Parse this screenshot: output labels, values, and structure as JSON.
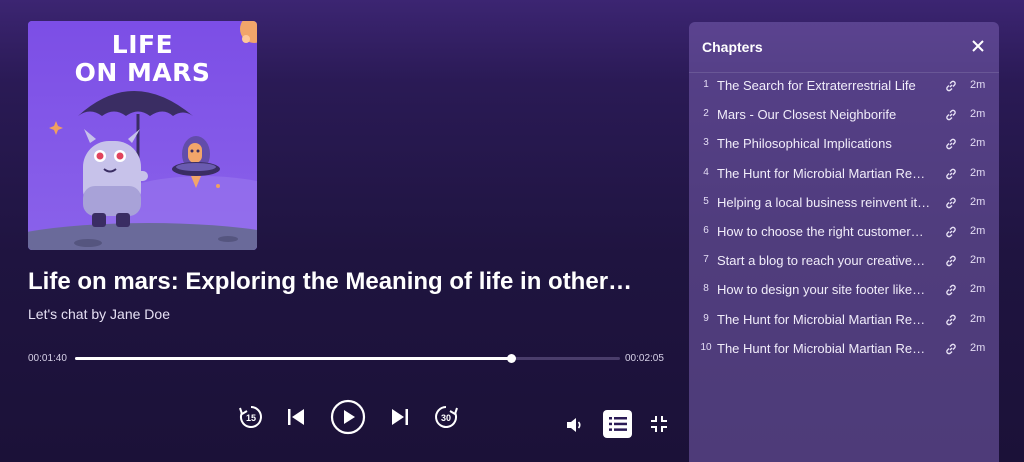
{
  "cover": {
    "title_line1": "LIFE",
    "title_line2": "ON MARS"
  },
  "episode": {
    "title": "Life on mars: Exploring the Meaning of life in other…",
    "subtitle": "Let's chat by Jane Doe"
  },
  "progress": {
    "current_time": "00:01:40",
    "total_time": "00:02:05",
    "fraction": 0.8
  },
  "controls": {
    "skip_back_label": "15",
    "skip_forward_label": "30"
  },
  "chapters": {
    "header": "Chapters",
    "items": [
      {
        "num": "1",
        "title": "The Search for Extraterrestrial Life",
        "duration": "2m"
      },
      {
        "num": "2",
        "title": "Mars - Our Closest Neighborife",
        "duration": "2m"
      },
      {
        "num": "3",
        "title": "The Philosophical Implications",
        "duration": "2m"
      },
      {
        "num": "4",
        "title": "The Hunt for Microbial Martian Resi…",
        "duration": "2m"
      },
      {
        "num": "5",
        "title": "Helping a local business reinvent it…",
        "duration": "2m"
      },
      {
        "num": "6",
        "title": "How to choose the right customer…",
        "duration": "2m"
      },
      {
        "num": "7",
        "title": "Start a blog to reach your creative…",
        "duration": "2m"
      },
      {
        "num": "8",
        "title": "How to design your site footer like…",
        "duration": "2m"
      },
      {
        "num": "9",
        "title": "The Hunt for Microbial Martian Resi…",
        "duration": "2m"
      },
      {
        "num": "10",
        "title": "The Hunt for Microbial Martian Resi…",
        "duration": "2m"
      }
    ]
  },
  "colors": {
    "background_top": "#3c2572",
    "background_bottom": "#1b1138",
    "cover_bg": "#7a55e0",
    "panel_bg": "#785faf"
  },
  "icons": [
    "skip-back-15-icon",
    "previous-icon",
    "play-icon",
    "next-icon",
    "skip-forward-30-icon",
    "volume-icon",
    "chapters-list-icon",
    "minimize-icon",
    "close-icon",
    "link-icon"
  ]
}
